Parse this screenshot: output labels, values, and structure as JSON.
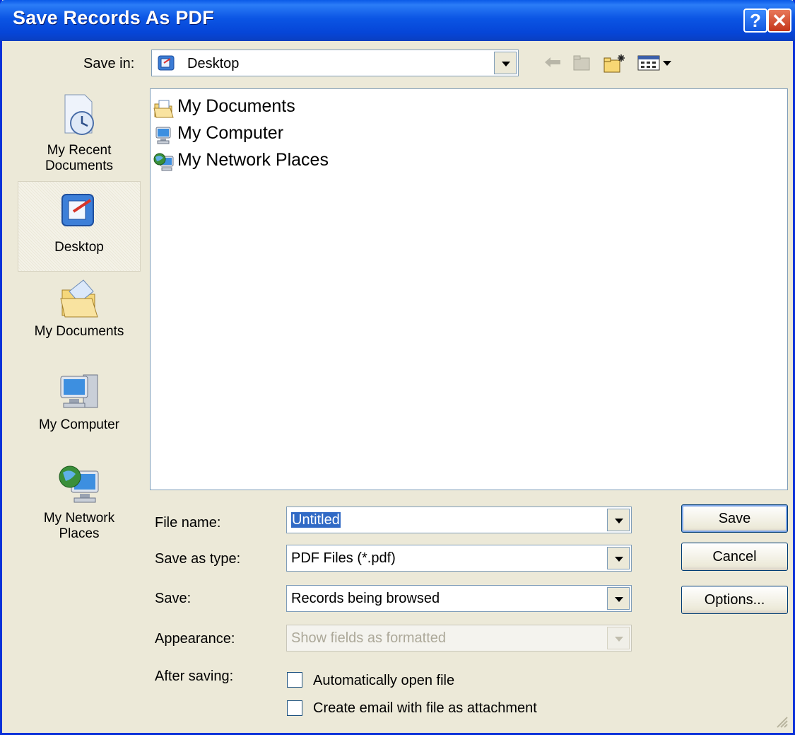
{
  "window": {
    "title": "Save Records As PDF",
    "help_glyph": "?",
    "close_glyph": "✕"
  },
  "save_in": {
    "label": "Save in:",
    "value": "Desktop"
  },
  "places": [
    {
      "label_line1": "My Recent",
      "label_line2": "Documents",
      "icon": "recent-documents-icon"
    },
    {
      "label_line1": "Desktop",
      "label_line2": "",
      "icon": "desktop-icon"
    },
    {
      "label_line1": "My Documents",
      "label_line2": "",
      "icon": "my-documents-icon"
    },
    {
      "label_line1": "My Computer",
      "label_line2": "",
      "icon": "my-computer-icon"
    },
    {
      "label_line1": "My Network",
      "label_line2": "Places",
      "icon": "network-places-icon"
    }
  ],
  "files": [
    {
      "name": "My Documents",
      "icon": "my-documents-icon"
    },
    {
      "name": "My Computer",
      "icon": "my-computer-icon"
    },
    {
      "name": "My Network Places",
      "icon": "network-places-icon"
    }
  ],
  "form": {
    "file_name_label": "File name:",
    "file_name_value": "Untitled",
    "save_as_type_label": "Save as type:",
    "save_as_type_value": "PDF Files (*.pdf)",
    "save_label": "Save:",
    "save_value": "Records being browsed",
    "appearance_label": "Appearance:",
    "appearance_value": "Show fields as formatted",
    "after_saving_label": "After saving:",
    "auto_open_label": "Automatically open file",
    "auto_open_checked": false,
    "email_label": "Create email with file as attachment",
    "email_checked": false
  },
  "buttons": {
    "save": "Save",
    "cancel": "Cancel",
    "options": "Options..."
  },
  "colors": {
    "titlebar": "#0a5ae8",
    "dialog_bg": "#ece9d8",
    "selection": "#316ac5"
  }
}
